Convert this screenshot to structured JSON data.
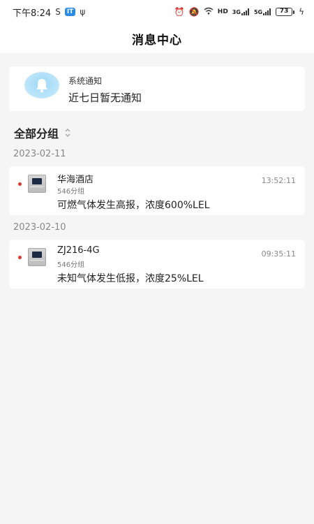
{
  "status_bar": {
    "time": "下午8:24",
    "net_left": "S",
    "app_badge": "IT",
    "usb": "ψ",
    "signal_1": "HD",
    "net_3g": "3G",
    "net_5g": "5G",
    "battery": "73"
  },
  "nav": {
    "title": "消息中心"
  },
  "system_notice": {
    "title": "系统通知",
    "text": "近七日暂无通知"
  },
  "group_filter": {
    "label": "全部分组"
  },
  "messages": [
    {
      "date": "2023-02-11",
      "name": "华海酒店",
      "group": "546分组",
      "time": "13:52:11",
      "text": "可燃气体发生高报，浓度600%LEL"
    },
    {
      "date": "2023-02-10",
      "name": "ZJ216-4G",
      "group": "546分组",
      "time": "09:35:11",
      "text": "未知气体发生低报，浓度25%LEL"
    }
  ],
  "colors": {
    "background": "#f5f5f5",
    "card": "#ffffff",
    "unread_dot": "#d93a2e",
    "bell_bg": "#b9e4fa",
    "secondary_text": "#888888"
  }
}
